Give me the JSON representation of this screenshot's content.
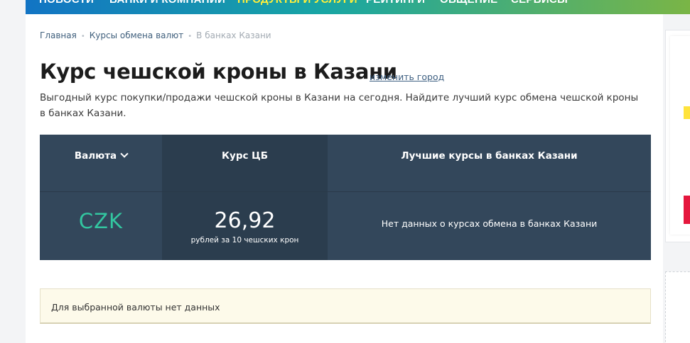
{
  "nav": {
    "items": [
      {
        "label": "НОВОСТИ",
        "active": false
      },
      {
        "label": "БАНКИ И КОМПАНИИ",
        "active": false
      },
      {
        "label": "ПРОДУКТЫ И УСЛУГИ",
        "active": true
      },
      {
        "label": "РЕЙТИНГИ",
        "active": false
      },
      {
        "label": "ОБЩЕНИЕ",
        "active": false
      },
      {
        "label": "СЕРВИСЫ",
        "active": false
      }
    ]
  },
  "breadcrumb": {
    "items": [
      "Главная",
      "Курсы обмена валют"
    ],
    "current": "В банках Казани"
  },
  "page": {
    "title": "Курс чешской кроны в Казани",
    "change_city": "изменить город",
    "description": "Выгодный курс покупки/продажи чешской кроны в Казани на сегодня. Найдите лучший курс обмена чешской кроны в банках Казани."
  },
  "table": {
    "headers": {
      "currency": "Валюта",
      "cb": "Курс ЦБ",
      "best": "Лучшие курсы в банках Казани"
    },
    "row": {
      "code": "CZK",
      "cb_value": "26,92",
      "cb_unit": "рублей за 10 чешских крон",
      "best_text": "Нет данных о курсах обмена в банках Казани"
    }
  },
  "notice": {
    "text": "Для выбранной валюты нет данных"
  },
  "colors": {
    "table_bg": "#33475b",
    "currency_code": "#33c6a0",
    "active_nav": "#ffef3a"
  }
}
